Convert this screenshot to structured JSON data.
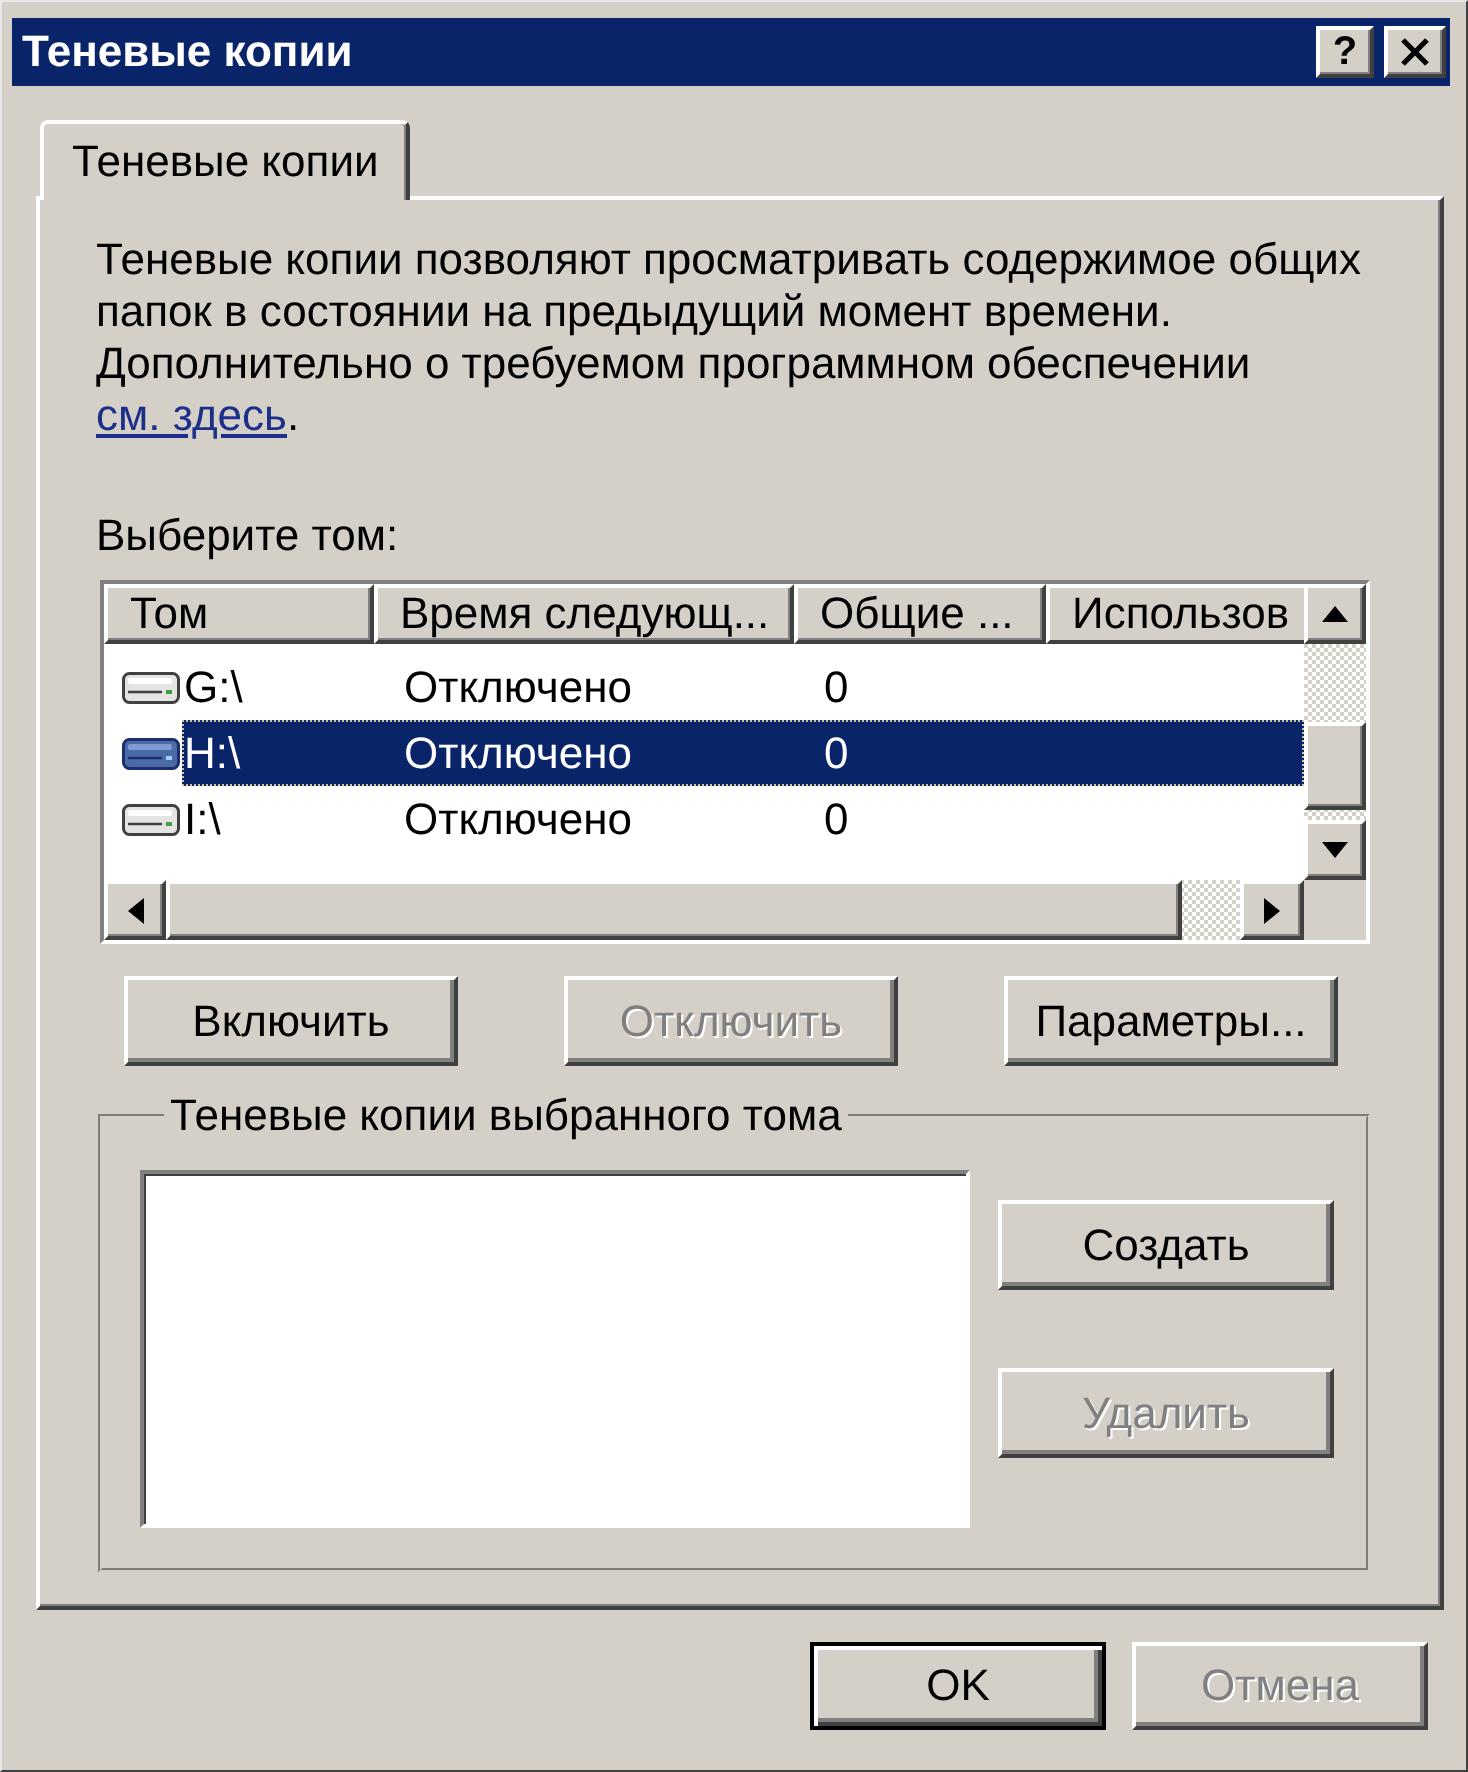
{
  "window": {
    "title": "Теневые копии",
    "help_label": "?"
  },
  "tabs": [
    {
      "label": "Теневые копии",
      "selected": true
    }
  ],
  "description": {
    "text": "Теневые копии позволяют просматривать содержимое общих папок в состоянии на предыдущий момент времени. Дополнительно о требуемом программном обеспечении",
    "link": "см. здесь",
    "tail": "."
  },
  "volumes": {
    "label": "Выберите том:",
    "columns": [
      "Том",
      "Время следующ...",
      "Общие ...",
      "Использов"
    ],
    "rows": [
      {
        "cells": [
          "G:\\",
          "Отключено",
          "0"
        ],
        "selected": false
      },
      {
        "cells": [
          "H:\\",
          "Отключено",
          "0"
        ],
        "selected": true
      },
      {
        "cells": [
          "I:\\",
          "Отключено",
          "0"
        ],
        "selected": false
      }
    ]
  },
  "volume_buttons": [
    {
      "label": "Включить",
      "disabled": false
    },
    {
      "label": "Отключить",
      "disabled": true
    },
    {
      "label": "Параметры...",
      "disabled": false
    }
  ],
  "snapshots": {
    "title": "Теневые копии выбранного тома",
    "buttons": [
      {
        "label": "Создать",
        "disabled": false
      },
      {
        "label": "Удалить",
        "disabled": true
      }
    ]
  },
  "footer_buttons": [
    {
      "label": "OK",
      "disabled": false,
      "default": true
    },
    {
      "label": "Отмена",
      "disabled": true,
      "default": false
    }
  ]
}
